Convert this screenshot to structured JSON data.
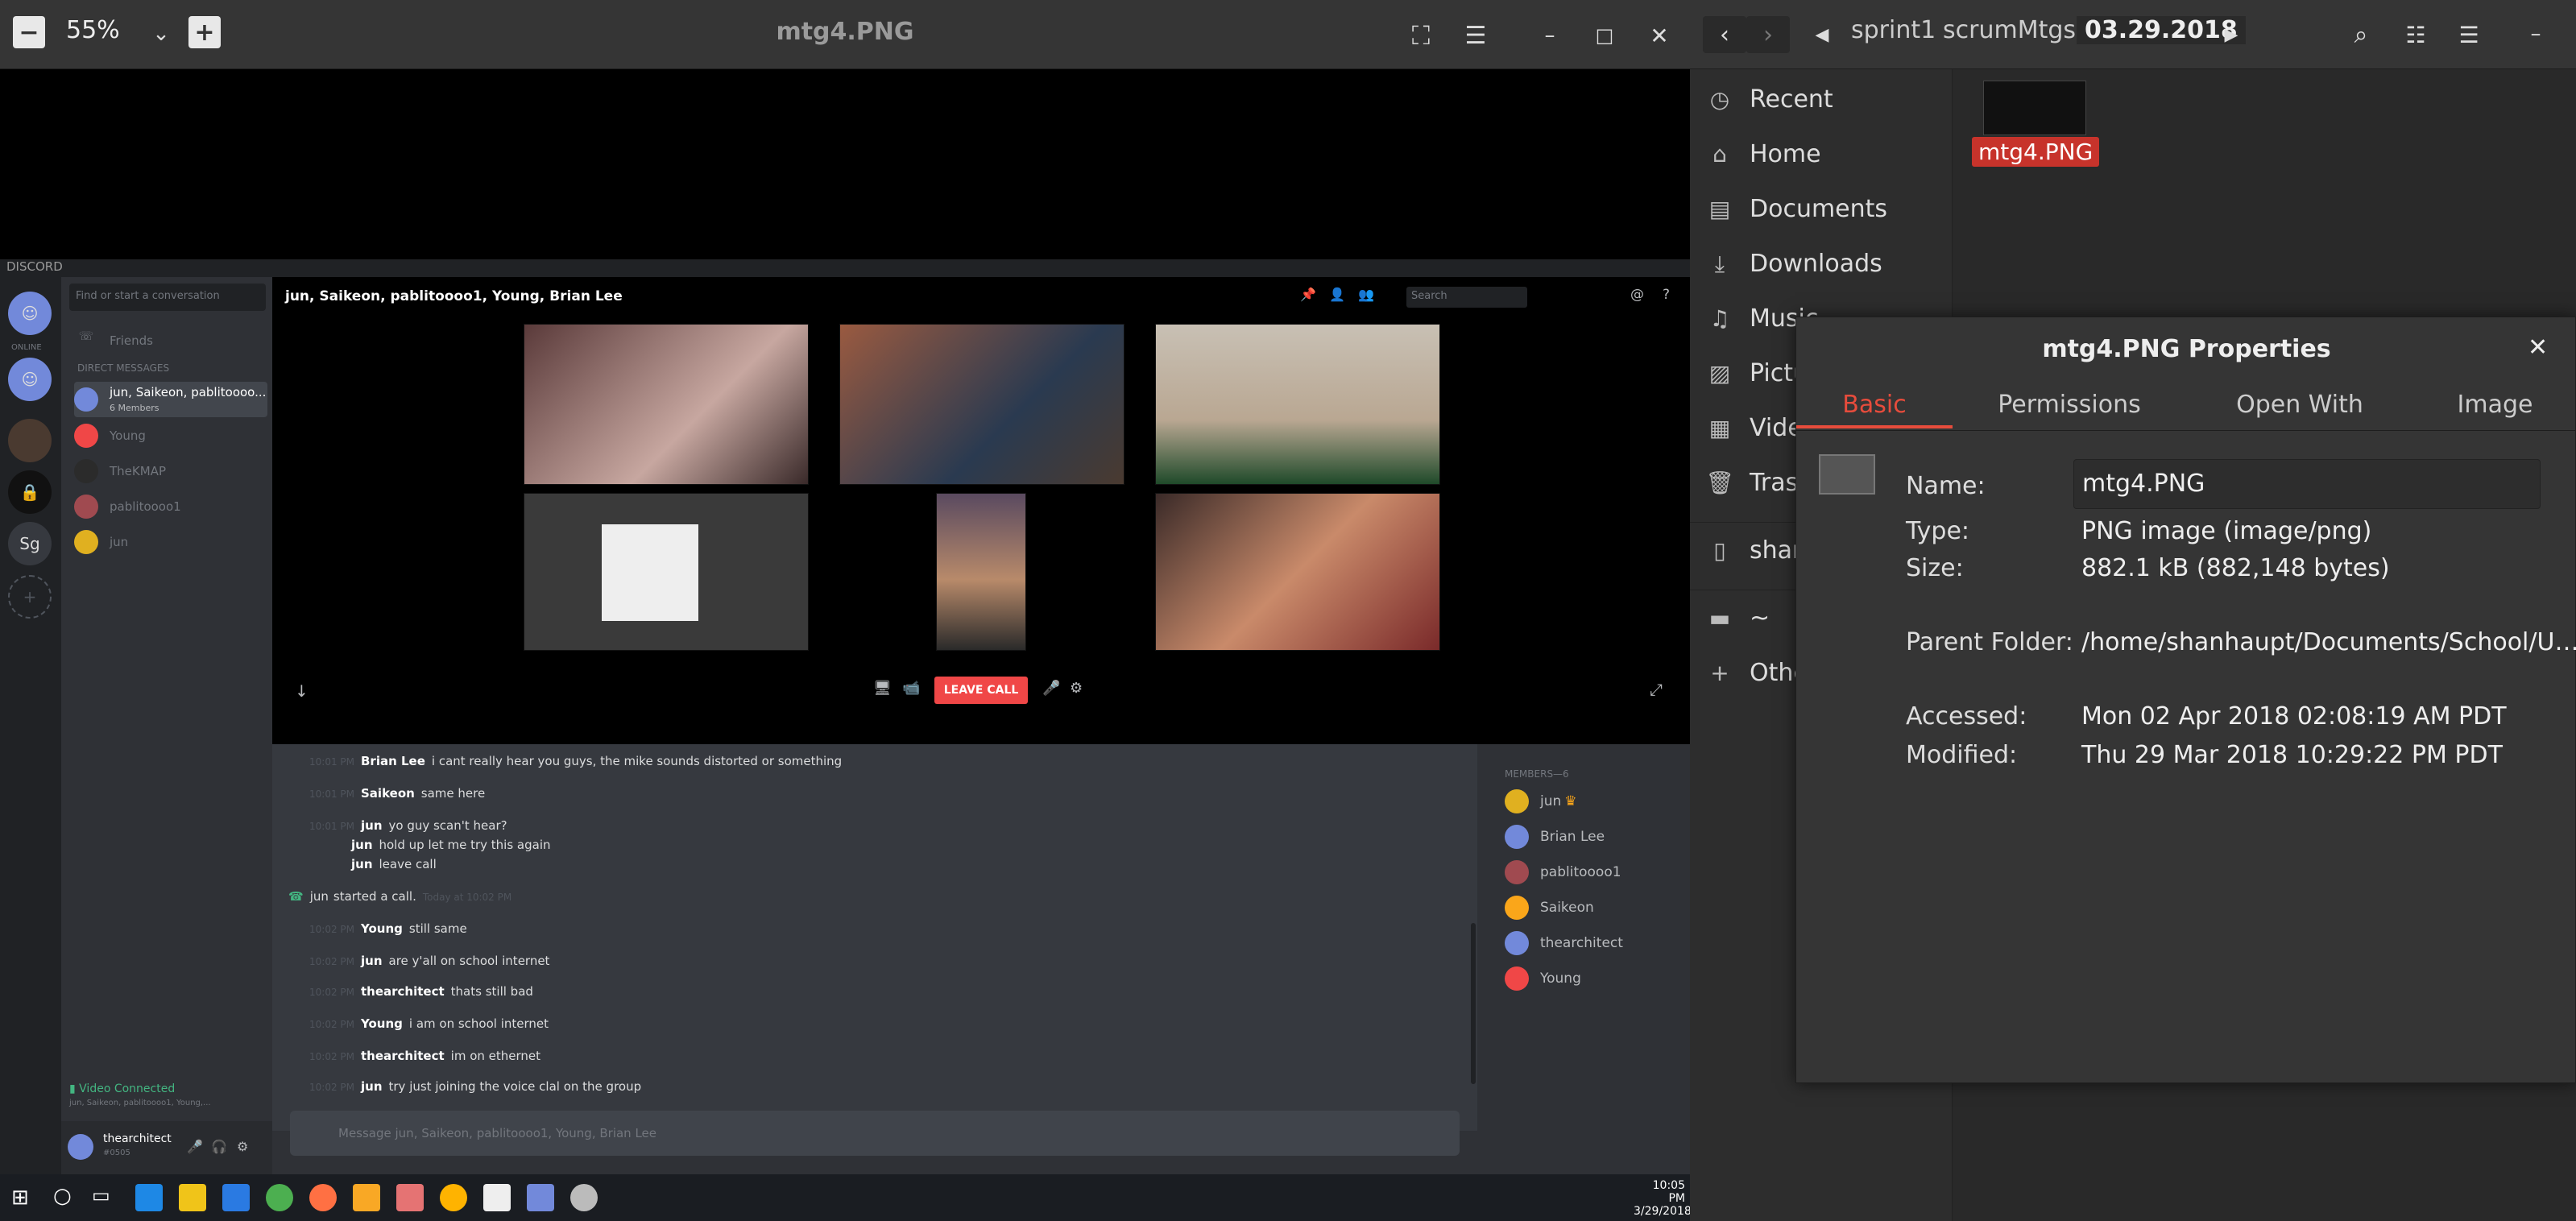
{
  "viewer": {
    "zoom": "55%",
    "title": "mtg4.PNG"
  },
  "discord": {
    "brand": "DISCORD",
    "search_placeholder": "Find or start a conversation",
    "friends": "Friends",
    "direct_messages": "DIRECT MESSAGES",
    "dm_items": [
      {
        "name": "jun, Saikeon, pablitoooo...",
        "sub": "6 Members"
      },
      {
        "name": "Young"
      },
      {
        "name": "TheKMAP"
      },
      {
        "name": "pablitoooo1"
      },
      {
        "name": "jun"
      }
    ],
    "server_labels": [
      "ONLINE",
      "Sg"
    ],
    "call_title": "jun, Saikeon, pablitoooo1, Young, Brian Lee",
    "call_search": "Search",
    "leave_call": "LEAVE CALL",
    "messages": [
      {
        "time": "10:01 PM",
        "name": "Brian Lee",
        "text": "i cant really hear you guys, the mike sounds distorted or something"
      },
      {
        "time": "10:01 PM",
        "name": "Saikeon",
        "text": "same here"
      },
      {
        "time": "10:01 PM",
        "name": "jun",
        "text": "yo guy scan't hear?"
      },
      {
        "time": "",
        "name": "jun",
        "text": "hold up let me try this again"
      },
      {
        "time": "",
        "name": "jun",
        "text": "leave call"
      },
      {
        "time": "10:02 PM",
        "name": "Young",
        "text": "still same"
      },
      {
        "time": "10:02 PM",
        "name": "jun",
        "text": "are y'all on school internet"
      },
      {
        "time": "10:02 PM",
        "name": "thearchitect",
        "text": "thats still bad"
      },
      {
        "time": "10:02 PM",
        "name": "Young",
        "text": "i am on school internet"
      },
      {
        "time": "10:02 PM",
        "name": "thearchitect",
        "text": "im on ethernet"
      },
      {
        "time": "10:02 PM",
        "name": "jun",
        "text": "try just joining the voice clal on the group"
      }
    ],
    "call_event": {
      "name": "jun",
      "text": "started a call.",
      "time": "Today at 10:02 PM"
    },
    "members_header": "MEMBERS—6",
    "members": [
      "jun",
      "Brian Lee",
      "pablitoooo1",
      "Saikeon",
      "thearchitect",
      "Young"
    ],
    "message_placeholder": "Message jun, Saikeon, pablitoooo1, Young, Brian Lee",
    "voice_status": "Video Connected",
    "voice_sub": "jun, Saikeon, pablitoooo1, Young,...",
    "user": {
      "name": "thearchitect",
      "tag": "#0505"
    }
  },
  "taskbar": {
    "time": "10:05 PM",
    "date": "3/29/2018"
  },
  "files": {
    "breadcrumbs": [
      "sprint1",
      "scrumMtgs",
      "03.29.2018"
    ],
    "sidebar": [
      "Recent",
      "Home",
      "Documents",
      "Downloads",
      "Music",
      "Pictures",
      "Videos",
      "Trash",
      "shanhaupt",
      "~",
      "Other Locations"
    ],
    "file_label": "mtg4.PNG"
  },
  "properties": {
    "title": "mtg4.PNG Properties",
    "tabs": [
      "Basic",
      "Permissions",
      "Open With",
      "Image"
    ],
    "name_label": "Name:",
    "name_value": "mtg4.PNG",
    "type_label": "Type:",
    "type_value": "PNG image (image/png)",
    "size_label": "Size:",
    "size_value": "882.1 kB (882,148 bytes)",
    "parent_label": "Parent Folder:",
    "parent_value": "/home/shanhaupt/Documents/School/U…",
    "accessed_label": "Accessed:",
    "accessed_value": "Mon 02 Apr 2018 02:08:19 AM PDT",
    "modified_label": "Modified:",
    "modified_value": "Thu 29 Mar 2018 10:29:22 PM PDT"
  },
  "colors": {
    "accent": "#e74c3c",
    "discord_blurple": "#7289da",
    "leave": "#f04747"
  }
}
